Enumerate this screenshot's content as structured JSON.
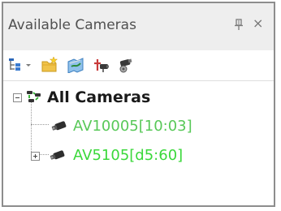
{
  "panel": {
    "title": "Available Cameras",
    "pin_icon": "pin-icon",
    "close_glyph": "×"
  },
  "toolbar": {
    "buttons": [
      {
        "name": "tree-view-dropdown-button",
        "icon": "tree-view-icon"
      },
      {
        "name": "new-folder-button",
        "icon": "new-folder-icon"
      },
      {
        "name": "map-button",
        "icon": "map-icon"
      },
      {
        "name": "add-camera-button",
        "icon": "add-camera-icon"
      },
      {
        "name": "camera-settings-button",
        "icon": "camera-settings-icon"
      }
    ]
  },
  "tree": {
    "root": {
      "label": "All Cameras",
      "expanded": true,
      "icon": "camera-group-icon"
    },
    "items": [
      {
        "label": "AV10005[10:03]",
        "icon": "camera-icon",
        "expandable": false,
        "color": "#58c858"
      },
      {
        "label": "AV5105[d5:60]",
        "icon": "camera-icon",
        "expandable": true,
        "expanded": false,
        "color": "#3ad83a"
      }
    ]
  }
}
